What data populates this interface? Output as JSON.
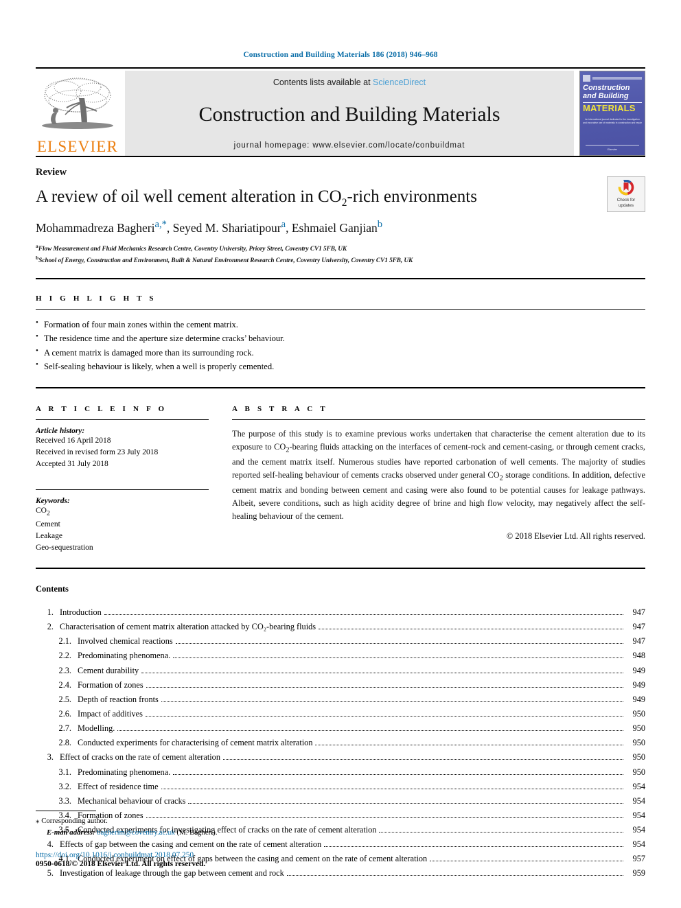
{
  "running_head": "Construction and Building Materials 186 (2018) 946–968",
  "masthead": {
    "publisher": "ELSEVIER",
    "contents_prefix": "Contents lists available at ",
    "contents_link": "ScienceDirect",
    "journal_title": "Construction and Building Materials",
    "homepage": "journal homepage: www.elsevier.com/locate/conbuildmat",
    "cover": {
      "line1": "Construction",
      "line2": "and Building",
      "line3": "MATERIALS",
      "blurb": "An international journal dedicated to the investigation and innovative use of materials in construction and repair",
      "footer": "Elsevier"
    }
  },
  "article": {
    "kicker": "Review",
    "title_part1": "A review of oil well cement alteration in CO",
    "title_sub": "2",
    "title_part2": "-rich environments",
    "authors": [
      {
        "name": "Mohammadreza Bagheri",
        "marks": "a,*"
      },
      {
        "name": "Seyed M. Shariatipour",
        "marks": "a"
      },
      {
        "name": "Eshmaiel Ganjian",
        "marks": "b"
      }
    ],
    "affiliations": [
      {
        "mark": "a",
        "text": "Flow Measurement and Fluid Mechanics Research Centre, Coventry University, Priory Street, Coventry CV1 5FB, UK"
      },
      {
        "mark": "b",
        "text": "School of Energy, Construction and Environment, Built & Natural Environment Research Centre, Coventry University, Coventry CV1 5FB, UK"
      }
    ],
    "crossmark_label": "Check for\nupdates"
  },
  "highlights": {
    "heading": "H I G H L I G H T S",
    "items": [
      "Formation of four main zones within the cement matrix.",
      "The residence time and the aperture size determine cracks’ behaviour.",
      "A cement matrix is damaged more than its surrounding rock.",
      "Self-sealing behaviour is likely, when a well is properly cemented."
    ]
  },
  "article_info": {
    "heading": "A R T I C L E    I N F O",
    "history_label": "Article history:",
    "history": [
      "Received 16 April 2018",
      "Received in revised form 23 July 2018",
      "Accepted 31 July 2018"
    ],
    "keywords_label": "Keywords:",
    "keywords_plain": [
      "CO",
      "Cement",
      "Leakage",
      "Geo-sequestration"
    ],
    "keyword_co2_sub": "2"
  },
  "abstract": {
    "heading": "A B S T R A C T",
    "text_part1": "The purpose of this study is to examine previous works undertaken that characterise the cement alteration due to its exposure to CO",
    "sub1": "2",
    "text_part2": "-bearing fluids attacking on the interfaces of cement-rock and cement-casing, or through cement cracks, and the cement matrix itself. Numerous studies have reported carbonation of well cements. The majority of studies reported self-healing behaviour of cements cracks observed under general CO",
    "sub2": "2",
    "text_part3": " storage conditions. In addition, defective cement matrix and bonding between cement and casing were also found to be potential causes for leakage pathways. Albeit, severe conditions, such as high acidity degree of brine and high flow velocity, may negatively affect the self-healing behaviour of the cement.",
    "copyright": "© 2018 Elsevier Ltd. All rights reserved."
  },
  "contents": {
    "heading": "Contents",
    "entries": [
      {
        "level": 1,
        "num": "1.",
        "label": "Introduction",
        "page": "947"
      },
      {
        "level": 1,
        "num": "2.",
        "label": "Characterisation of cement matrix alteration attacked by CO₂-bearing fluids",
        "page": "947"
      },
      {
        "level": 2,
        "num": "2.1.",
        "label": "Involved chemical reactions",
        "page": "947"
      },
      {
        "level": 2,
        "num": "2.2.",
        "label": "Predominating phenomena.",
        "page": "948"
      },
      {
        "level": 2,
        "num": "2.3.",
        "label": "Cement durability",
        "page": "949"
      },
      {
        "level": 2,
        "num": "2.4.",
        "label": "Formation of zones",
        "page": "949"
      },
      {
        "level": 2,
        "num": "2.5.",
        "label": "Depth of reaction fronts",
        "page": "949"
      },
      {
        "level": 2,
        "num": "2.6.",
        "label": "Impact of additives",
        "page": "950"
      },
      {
        "level": 2,
        "num": "2.7.",
        "label": "Modelling.",
        "page": "950"
      },
      {
        "level": 2,
        "num": "2.8.",
        "label": "Conducted experiments for characterising of cement matrix alteration",
        "page": "950"
      },
      {
        "level": 1,
        "num": "3.",
        "label": "Effect of cracks on the rate of cement alteration",
        "page": "950"
      },
      {
        "level": 2,
        "num": "3.1.",
        "label": "Predominating phenomena.",
        "page": "950"
      },
      {
        "level": 2,
        "num": "3.2.",
        "label": "Effect of residence time",
        "page": "954"
      },
      {
        "level": 2,
        "num": "3.3.",
        "label": "Mechanical behaviour of cracks",
        "page": "954"
      },
      {
        "level": 2,
        "num": "3.4.",
        "label": "Formation of zones",
        "page": "954"
      },
      {
        "level": 2,
        "num": "3.5.",
        "label": "Conducted experiments for investigating effect of cracks on the rate of cement alteration",
        "page": "954"
      },
      {
        "level": 1,
        "num": "4.",
        "label": "Effects of gap between the casing and cement on the rate of cement alteration",
        "page": "954"
      },
      {
        "level": 2,
        "num": "4.1.",
        "label": "Conducted experiment on effect of gaps between the casing and cement on the rate of cement alteration",
        "page": "957"
      },
      {
        "level": 1,
        "num": "5.",
        "label": "Investigation of leakage through the gap between cement and rock",
        "page": "959"
      }
    ]
  },
  "footer": {
    "corresponding": "Corresponding author.",
    "email_label": "E-mail address:",
    "email": "bagherim@coventry.ac.uk",
    "email_suffix": "(M. Bagheri).",
    "doi": "https://doi.org/10.1016/j.conbuildmat.2018.07.250",
    "issn": "0950-0618/© 2018 Elsevier Ltd. All rights reserved."
  },
  "colors": {
    "link_blue": "#0b6ea8",
    "sciencedirect_blue": "#4a9fd4",
    "elsevier_orange": "#ec8013",
    "banner_grey": "#e6e6e6",
    "cover_blue": "#5259ab",
    "cover_yellow": "#f2e43a"
  }
}
